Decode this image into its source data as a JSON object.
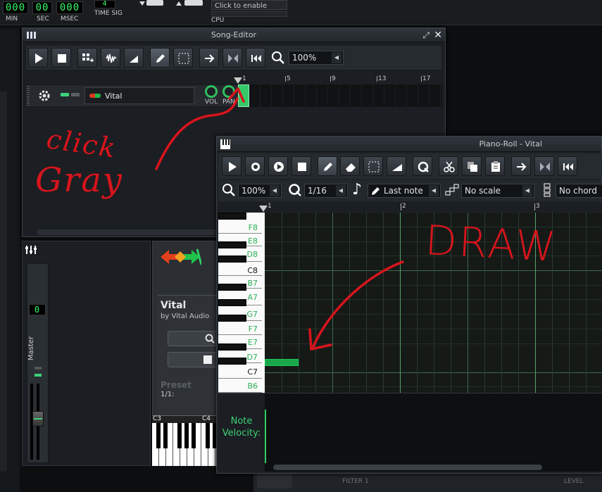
{
  "topbar": {
    "time": {
      "min": "000",
      "sec": "00",
      "msec": "000",
      "min_label": "MIN",
      "sec_label": "SEC",
      "msec_label": "MSEC"
    },
    "timesig": {
      "value": "4",
      "label": "TIME SIG"
    },
    "cpu": {
      "hint": "Click to enable",
      "label": "CPU"
    }
  },
  "song_editor": {
    "title": "Song-Editor",
    "zoom": "100%",
    "ruler": [
      "1",
      "5",
      "9",
      "13",
      "17"
    ],
    "track": {
      "name": "Vital",
      "vol_label": "VOL",
      "pan_label": "PAN"
    }
  },
  "piano_roll": {
    "title": "Piano-Roll - Vital",
    "zoom": "100%",
    "quantize": "1/16",
    "note_length": "Last note",
    "scale": "No scale",
    "chord": "No chord",
    "ruler": [
      "1",
      "2",
      "3"
    ],
    "keys": [
      "F8",
      "E8",
      "D8",
      "C8",
      "B7",
      "A7",
      "G7",
      "F7",
      "E7",
      "D7",
      "C7",
      "B6"
    ],
    "velocity_label": "Note\nVelocity:"
  },
  "mixer": {
    "value": "0",
    "label": "Master"
  },
  "instrument": {
    "name": "Vital",
    "vendor": "by Vital Audio",
    "preset_label": "Preset",
    "preset_value": "1/1:",
    "key_c3": "C3",
    "key_c4": "C4"
  },
  "bottom": {
    "filter": "FILTER 1",
    "level": "LEVEL"
  },
  "annotations": {
    "click": "click",
    "gray": "Gray",
    "draw": "DRAW"
  },
  "colors": {
    "accent": "#22d36a",
    "annotation": "#d8141c",
    "note": "#19a84a"
  }
}
